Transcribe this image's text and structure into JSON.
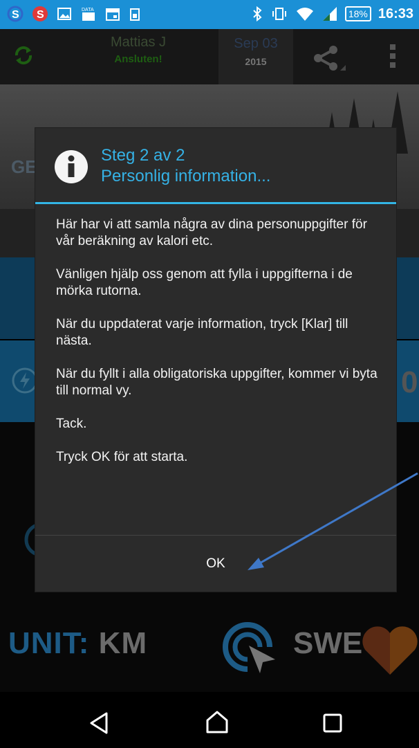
{
  "status_bar": {
    "battery": "18%",
    "time": "16:33"
  },
  "header": {
    "user_name": "Mattias J",
    "connection_status": "Ansluten!",
    "date_month_day": "Sep 03",
    "date_year": "2015"
  },
  "background": {
    "partial_label": "GE",
    "partial_digit": "0",
    "unit_label": "UNIT:",
    "unit_value": "KM",
    "country": "SWE"
  },
  "dialog": {
    "title_line1": "Steg 2 av 2",
    "title_line2": "Personlig information...",
    "paragraphs": [
      "Här har vi att samla några av dina personuppgifter för vår beräkning av kalori etc.",
      "Vänligen hjälp oss genom att fylla i uppgifterna i de mörka rutorna.",
      "När du uppdaterat varje information, tryck [Klar] till nästa.",
      "När du fyllt i alla obligatoriska uppgifter, kommer vi byta till normal vy.",
      "Tack.",
      "Tryck OK för att starta."
    ],
    "ok_label": "OK"
  },
  "colors": {
    "status_bar": "#1b90d6",
    "accent": "#33b5e5",
    "dialog_bg": "#2b2b2b",
    "arrow": "#3f78c8"
  }
}
